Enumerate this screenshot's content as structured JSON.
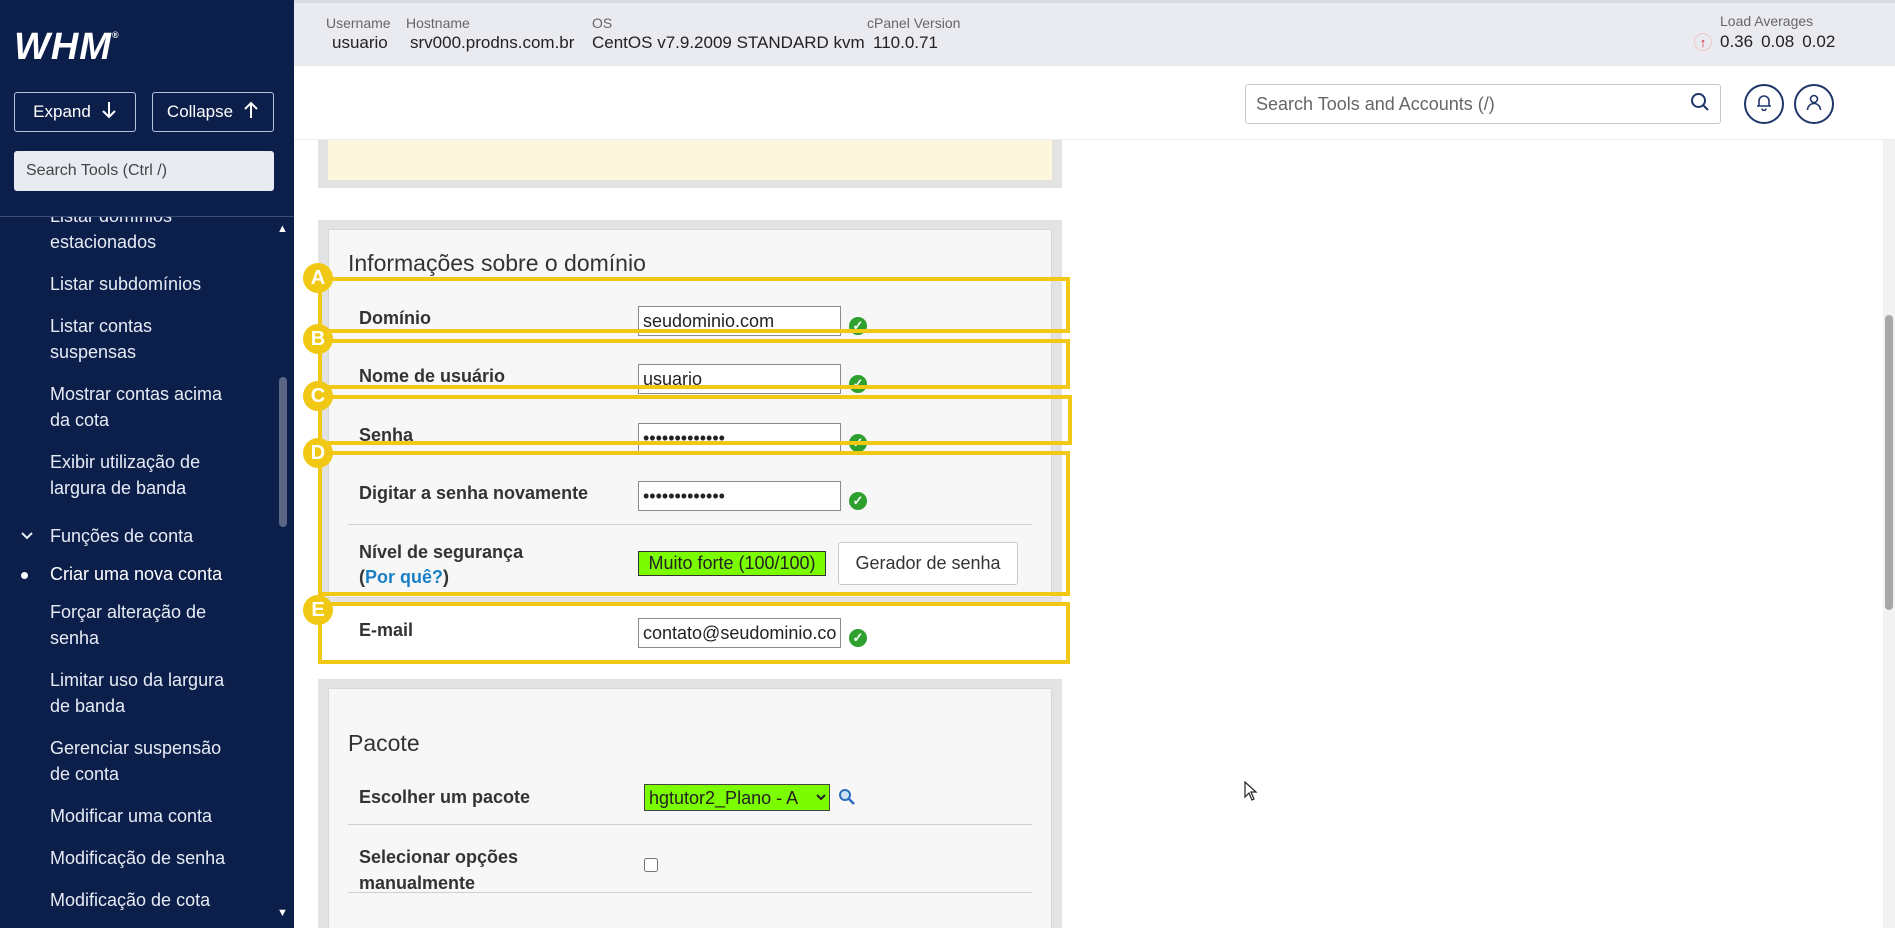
{
  "brand": {
    "logo_text": "WHM",
    "reg_mark": "®"
  },
  "sidebar": {
    "expand_label": "Expand",
    "collapse_label": "Collapse",
    "search_placeholder": "Search Tools (Ctrl /)",
    "items": [
      {
        "label": "Listar domínios estacionados"
      },
      {
        "label": "Listar subdomínios"
      },
      {
        "label": "Listar contas suspensas"
      },
      {
        "label": "Mostrar contas acima da cota"
      },
      {
        "label": "Exibir utilização de largura de banda"
      }
    ],
    "section": {
      "label": "Funções de conta"
    },
    "section_items": [
      {
        "label": "Criar uma nova conta",
        "active": true
      },
      {
        "label": "Forçar alteração de senha"
      },
      {
        "label": "Limitar uso da largura de banda"
      },
      {
        "label": "Gerenciar suspensão de conta"
      },
      {
        "label": "Modificar uma conta"
      },
      {
        "label": "Modificação de senha"
      },
      {
        "label": "Modificação de cota"
      }
    ]
  },
  "topbar": {
    "username_label": "Username",
    "username": "usuario",
    "hostname_label": "Hostname",
    "hostname": "srv000.prodns.com.br",
    "os_label": "OS",
    "os": "CentOS v7.9.2009 STANDARD kvm",
    "cpanel_label": "cPanel Version",
    "cpanel": "110.0.71",
    "load_label": "Load Averages",
    "load": [
      "0.36",
      "0.08",
      "0.02"
    ]
  },
  "header": {
    "search_placeholder": "Search Tools and Accounts (/)"
  },
  "domain_panel": {
    "title": "Informações sobre o domínio",
    "domain_label": "Domínio",
    "domain_value": "seudominio.com",
    "user_label": "Nome de usuário",
    "user_value": "usuario",
    "pass_label": "Senha",
    "pass_value": "•••••••••••••",
    "pass2_label": "Digitar a senha novamente",
    "pass2_value": "•••••••••••••",
    "strength_label": "Nível de segurança",
    "why_open": "(",
    "why_link": "Por quê?",
    "why_close": ")",
    "strength_value": "Muito forte (100/100)",
    "generator_label": "Gerador de senha",
    "email_label": "E-mail",
    "email_value": "contato@seudominio.com"
  },
  "annotations": [
    "A",
    "B",
    "C",
    "D",
    "E"
  ],
  "package_panel": {
    "title": "Pacote",
    "choose_label": "Escolher um pacote",
    "selected_package": "hgtutor2_Plano - A",
    "manual_label": "Selecionar opções manualmente"
  },
  "colors": {
    "sidebar_bg": "#0c1f4a",
    "annotation": "#f1c915",
    "strength_bg": "#7cfc00",
    "ok_green": "#2ea02e",
    "link": "#1a7fc4"
  }
}
